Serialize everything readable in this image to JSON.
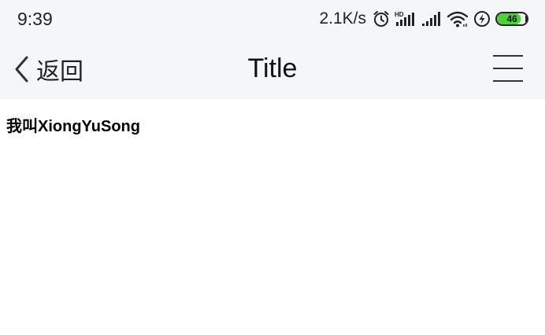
{
  "status_bar": {
    "time": "9:39",
    "net_speed": "2.1K/s",
    "battery_level": "46",
    "icons": [
      "alarm-icon",
      "hd-signal-icon",
      "signal-icon",
      "wifi-icon",
      "charging-icon",
      "battery-icon"
    ]
  },
  "nav": {
    "back_label": "返回",
    "title": "Title"
  },
  "content": {
    "text": "我叫XiongYuSong"
  },
  "colors": {
    "bar_background": "#f5f6f8",
    "battery_fill": "#4cd137"
  }
}
